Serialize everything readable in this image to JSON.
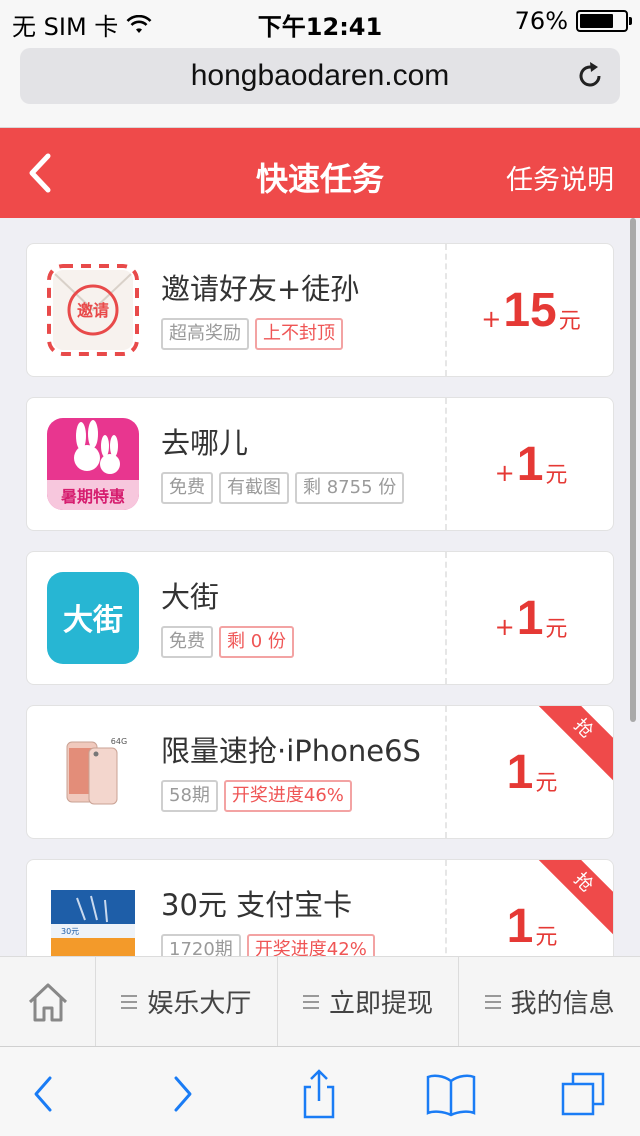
{
  "status": {
    "carrier": "无 SIM 卡",
    "time": "下午12:41",
    "battery": "76%",
    "battery_level": 0.76
  },
  "browser": {
    "url": "hongbaodaren.com"
  },
  "header": {
    "title": "快速任务",
    "help": "任务说明"
  },
  "tasks": [
    {
      "name": "邀请好友+徒孙",
      "tags": [
        {
          "text": "超高奖励",
          "style": "gray"
        },
        {
          "text": "上不封顶",
          "style": "red"
        }
      ],
      "plus": "+",
      "amount": "15",
      "unit": "元",
      "icon": "invite-envelope-icon",
      "icon_text": "邀请",
      "ribbon": ""
    },
    {
      "name": "去哪儿",
      "tags": [
        {
          "text": "免费",
          "style": "gray"
        },
        {
          "text": "有截图",
          "style": "gray"
        },
        {
          "text": "剩 8755 份",
          "style": "gray"
        }
      ],
      "plus": "+",
      "amount": "1",
      "unit": "元",
      "icon": "qunar-rabbit-icon",
      "icon_text": "暑期特惠",
      "ribbon": ""
    },
    {
      "name": "大街",
      "tags": [
        {
          "text": "免费",
          "style": "gray"
        },
        {
          "text": "剩 0 份",
          "style": "red"
        }
      ],
      "plus": "+",
      "amount": "1",
      "unit": "元",
      "icon": "dajie-icon",
      "icon_text": "大街",
      "ribbon": ""
    },
    {
      "name": "限量速抢·iPhone6S",
      "tags": [
        {
          "text": "58期",
          "style": "gray"
        },
        {
          "text": "开奖进度46%",
          "style": "red"
        }
      ],
      "plus": "",
      "amount": "1",
      "unit": "元",
      "icon": "iphone-icon",
      "icon_text": "64G",
      "ribbon": "抢"
    },
    {
      "name": "30元 支付宝卡",
      "tags": [
        {
          "text": "1720期",
          "style": "gray"
        },
        {
          "text": "开奖进度42%",
          "style": "red"
        }
      ],
      "plus": "",
      "amount": "1",
      "unit": "元",
      "icon": "alipay-card-icon",
      "icon_text": "30元",
      "ribbon": "抢"
    }
  ],
  "appnav": {
    "items": [
      "娱乐大厅",
      "立即提现",
      "我的信息"
    ]
  },
  "colors": {
    "accent": "#ef4a4a",
    "reward": "#e53935",
    "ios_blue": "#1a7cf5"
  }
}
